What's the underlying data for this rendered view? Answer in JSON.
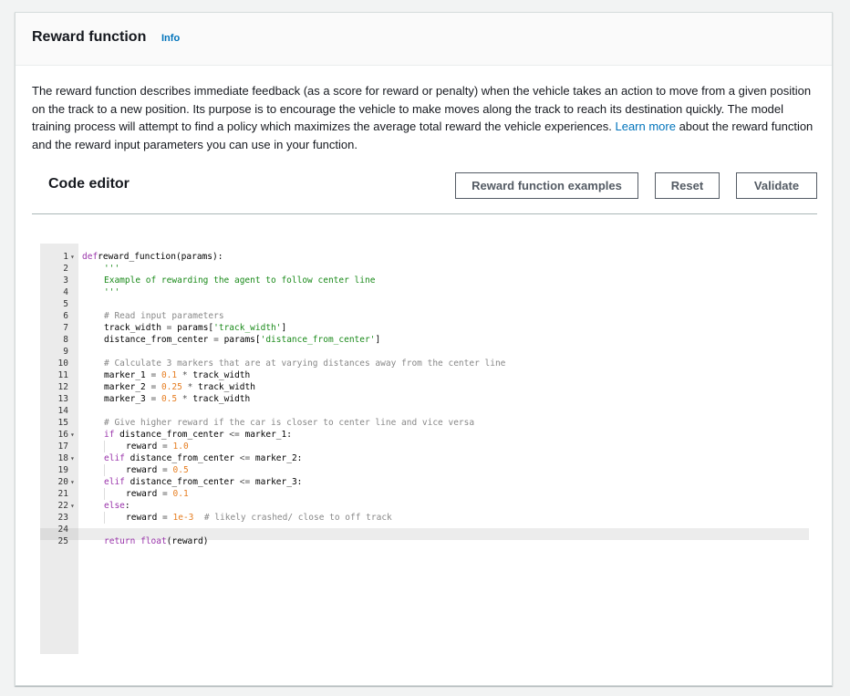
{
  "header": {
    "title": "Reward function",
    "info_label": "Info"
  },
  "description": {
    "text_before": "The reward function describes immediate feedback (as a score for reward or penalty) when the vehicle takes an action to move from a given position on the track to a new position. Its purpose is to encourage the vehicle to make moves along the track to reach its destination quickly. The model training process will attempt to find a policy which maximizes the average total reward the vehicle experiences. ",
    "link_text": "Learn more",
    "text_after": " about the reward function and the reward input parameters you can use in your function."
  },
  "editor": {
    "title": "Code editor",
    "buttons": {
      "examples": "Reward function examples",
      "reset": "Reset",
      "validate": "Validate"
    },
    "active_line": 25,
    "lines": [
      {
        "n": "1",
        "fold": true,
        "indent": 0,
        "tokens": [
          [
            "kw",
            "def"
          ],
          [
            "",
            "reward_function(params):"
          ]
        ]
      },
      {
        "n": "2",
        "fold": false,
        "indent": 1,
        "tokens": [
          [
            "str",
            "'''"
          ]
        ]
      },
      {
        "n": "3",
        "fold": false,
        "indent": 1,
        "tokens": [
          [
            "str",
            "Example of rewarding the agent to follow center line"
          ]
        ]
      },
      {
        "n": "4",
        "fold": false,
        "indent": 1,
        "tokens": [
          [
            "str",
            "'''"
          ]
        ]
      },
      {
        "n": "5",
        "fold": false,
        "indent": 0,
        "tokens": []
      },
      {
        "n": "6",
        "fold": false,
        "indent": 1,
        "tokens": [
          [
            "cmt",
            "# Read input parameters"
          ]
        ]
      },
      {
        "n": "7",
        "fold": false,
        "indent": 1,
        "tokens": [
          [
            "",
            "track_width "
          ],
          [
            "op",
            "="
          ],
          [
            "",
            " params["
          ],
          [
            "str",
            "'track_width'"
          ],
          [
            "",
            "]"
          ]
        ]
      },
      {
        "n": "8",
        "fold": false,
        "indent": 1,
        "tokens": [
          [
            "",
            "distance_from_center "
          ],
          [
            "op",
            "="
          ],
          [
            "",
            " params["
          ],
          [
            "str",
            "'distance_from_center'"
          ],
          [
            "",
            "]"
          ]
        ]
      },
      {
        "n": "9",
        "fold": false,
        "indent": 0,
        "tokens": []
      },
      {
        "n": "10",
        "fold": false,
        "indent": 1,
        "tokens": [
          [
            "cmt",
            "# Calculate 3 markers that are at varying distances away from the center line"
          ]
        ]
      },
      {
        "n": "11",
        "fold": false,
        "indent": 1,
        "tokens": [
          [
            "",
            "marker_1 "
          ],
          [
            "op",
            "="
          ],
          [
            "",
            " "
          ],
          [
            "num",
            "0.1"
          ],
          [
            "",
            " "
          ],
          [
            "op",
            "*"
          ],
          [
            "",
            " track_width"
          ]
        ]
      },
      {
        "n": "12",
        "fold": false,
        "indent": 1,
        "tokens": [
          [
            "",
            "marker_2 "
          ],
          [
            "op",
            "="
          ],
          [
            "",
            " "
          ],
          [
            "num",
            "0.25"
          ],
          [
            "",
            " "
          ],
          [
            "op",
            "*"
          ],
          [
            "",
            " track_width"
          ]
        ]
      },
      {
        "n": "13",
        "fold": false,
        "indent": 1,
        "tokens": [
          [
            "",
            "marker_3 "
          ],
          [
            "op",
            "="
          ],
          [
            "",
            " "
          ],
          [
            "num",
            "0.5"
          ],
          [
            "",
            " "
          ],
          [
            "op",
            "*"
          ],
          [
            "",
            " track_width"
          ]
        ]
      },
      {
        "n": "14",
        "fold": false,
        "indent": 0,
        "tokens": []
      },
      {
        "n": "15",
        "fold": false,
        "indent": 1,
        "tokens": [
          [
            "cmt",
            "# Give higher reward if the car is closer to center line and vice versa"
          ]
        ]
      },
      {
        "n": "16",
        "fold": true,
        "indent": 1,
        "tokens": [
          [
            "kw",
            "if"
          ],
          [
            "",
            " distance_from_center "
          ],
          [
            "op",
            "<="
          ],
          [
            "",
            " marker_1:"
          ]
        ]
      },
      {
        "n": "17",
        "fold": false,
        "indent": 2,
        "tokens": [
          [
            "",
            "reward "
          ],
          [
            "op",
            "="
          ],
          [
            "",
            " "
          ],
          [
            "num",
            "1.0"
          ]
        ]
      },
      {
        "n": "18",
        "fold": true,
        "indent": 1,
        "tokens": [
          [
            "kw",
            "elif"
          ],
          [
            "",
            " distance_from_center "
          ],
          [
            "op",
            "<="
          ],
          [
            "",
            " marker_2:"
          ]
        ]
      },
      {
        "n": "19",
        "fold": false,
        "indent": 2,
        "tokens": [
          [
            "",
            "reward "
          ],
          [
            "op",
            "="
          ],
          [
            "",
            " "
          ],
          [
            "num",
            "0.5"
          ]
        ]
      },
      {
        "n": "20",
        "fold": true,
        "indent": 1,
        "tokens": [
          [
            "kw",
            "elif"
          ],
          [
            "",
            " distance_from_center "
          ],
          [
            "op",
            "<="
          ],
          [
            "",
            " marker_3:"
          ]
        ]
      },
      {
        "n": "21",
        "fold": false,
        "indent": 2,
        "tokens": [
          [
            "",
            "reward "
          ],
          [
            "op",
            "="
          ],
          [
            "",
            " "
          ],
          [
            "num",
            "0.1"
          ]
        ]
      },
      {
        "n": "22",
        "fold": true,
        "indent": 1,
        "tokens": [
          [
            "kw",
            "else"
          ],
          [
            "",
            ":"
          ]
        ]
      },
      {
        "n": "23",
        "fold": false,
        "indent": 2,
        "tokens": [
          [
            "",
            "reward "
          ],
          [
            "op",
            "="
          ],
          [
            "",
            " "
          ],
          [
            "num",
            "1e-3"
          ],
          [
            "",
            "  "
          ],
          [
            "cmt",
            "# likely crashed/ close to off track"
          ]
        ]
      },
      {
        "n": "24",
        "fold": false,
        "indent": 0,
        "tokens": []
      },
      {
        "n": "25",
        "fold": false,
        "indent": 1,
        "tokens": [
          [
            "kw",
            "return"
          ],
          [
            "",
            " "
          ],
          [
            "kw",
            "float"
          ],
          [
            "",
            "(reward)"
          ]
        ]
      }
    ]
  }
}
